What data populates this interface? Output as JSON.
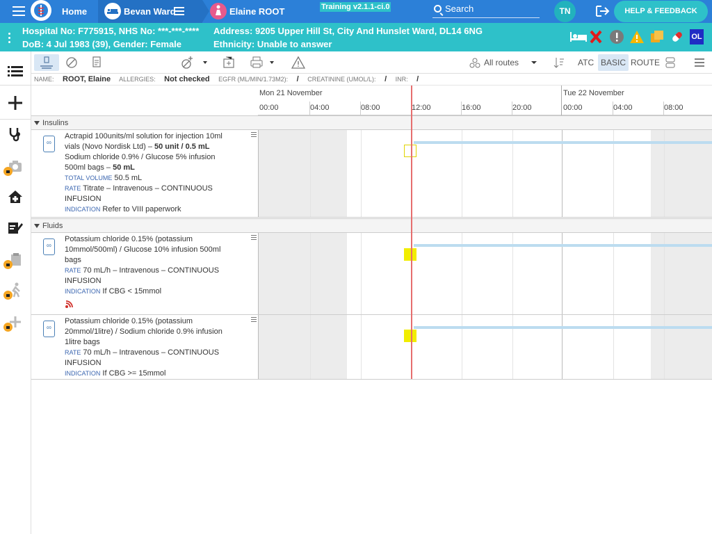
{
  "nav": {
    "home": "Home",
    "ward": "Bevan Ward",
    "patient": "Elaine ROOT",
    "training": "Training v2.1.1-ci.0",
    "search_placeholder": "Search",
    "user_initials": "TN",
    "help": "HELP & FEEDBACK"
  },
  "patient": {
    "hospital_line": "Hospital No: F775915, NHS No: ***-***-****",
    "dob_line": "DoB: 4 Jul 1983 (39), Gender: Female",
    "address_line": "Address: 9205 Upper Hill St, City And Hunslet Ward, DL14 6NG",
    "ethnicity_line": "Ethnicity: Unable to answer",
    "ol_badge": "OL"
  },
  "toolbar": {
    "routes": "All routes",
    "atc": "ATC",
    "basic": "BASIC",
    "route": "ROUTE"
  },
  "info": {
    "name_label": "NAME:",
    "name": "ROOT, Elaine",
    "allergies_label": "ALLERGIES:",
    "allergies": "Not checked",
    "egfr_label": "EGFR (ML/MIN/1.73M2):",
    "egfr": "/",
    "creat_label": "CREATININE (UMOL/L):",
    "creat": "/",
    "inr_label": "INR:",
    "inr": "/"
  },
  "timeline": {
    "day1": "Mon 21 November",
    "day2": "Tue 22 November",
    "hours": [
      "00:00",
      "04:00",
      "08:00",
      "12:00",
      "16:00",
      "20:00",
      "00:00",
      "04:00",
      "08:00"
    ]
  },
  "groups": {
    "insulins": "Insulins",
    "fluids": "Fluids"
  },
  "meds": [
    {
      "line1": "Actrapid 100units/ml solution for injection 10ml",
      "line2a": "vials (Novo Nordisk Ltd) – ",
      "line2b": "50 unit / 0.5 mL",
      "line3": "Sodium chloride 0.9% / Glucose 5% infusion",
      "line4a": "500ml bags – ",
      "line4b": "50 mL",
      "vol_label": "TOTAL VOLUME",
      "vol": "50.5 mL",
      "rate_label": "RATE",
      "rate1": "Titrate – Intravenous – CONTINUOUS",
      "rate2": "INFUSION",
      "ind_label": "INDICATION",
      "ind": "Refer to VIII paperwork"
    },
    {
      "line1": "Potassium chloride 0.15% (potassium",
      "line2": "10mmol/500ml) / Glucose 10% infusion 500ml",
      "line3": "bags",
      "rate_label": "RATE",
      "rate1": "70 mL/h – Intravenous – CONTINUOUS",
      "rate2": "INFUSION",
      "ind_label": "INDICATION",
      "ind": "If CBG < 15mmol"
    },
    {
      "line1": "Potassium chloride 0.15% (potassium",
      "line2": "20mmol/1litre) / Sodium chloride 0.9% infusion",
      "line3": "1litre bags",
      "rate_label": "RATE",
      "rate1": "70 mL/h – Intravenous – CONTINUOUS",
      "rate2": "INFUSION",
      "ind_label": "INDICATION",
      "ind": "If CBG >= 15mmol"
    }
  ],
  "colors": {
    "topbar": "#2c80d8",
    "patbar": "#2ec1c9",
    "now_line": "#e66e6e",
    "bar": "#bcdcf0",
    "marker": "#f1ed00"
  }
}
